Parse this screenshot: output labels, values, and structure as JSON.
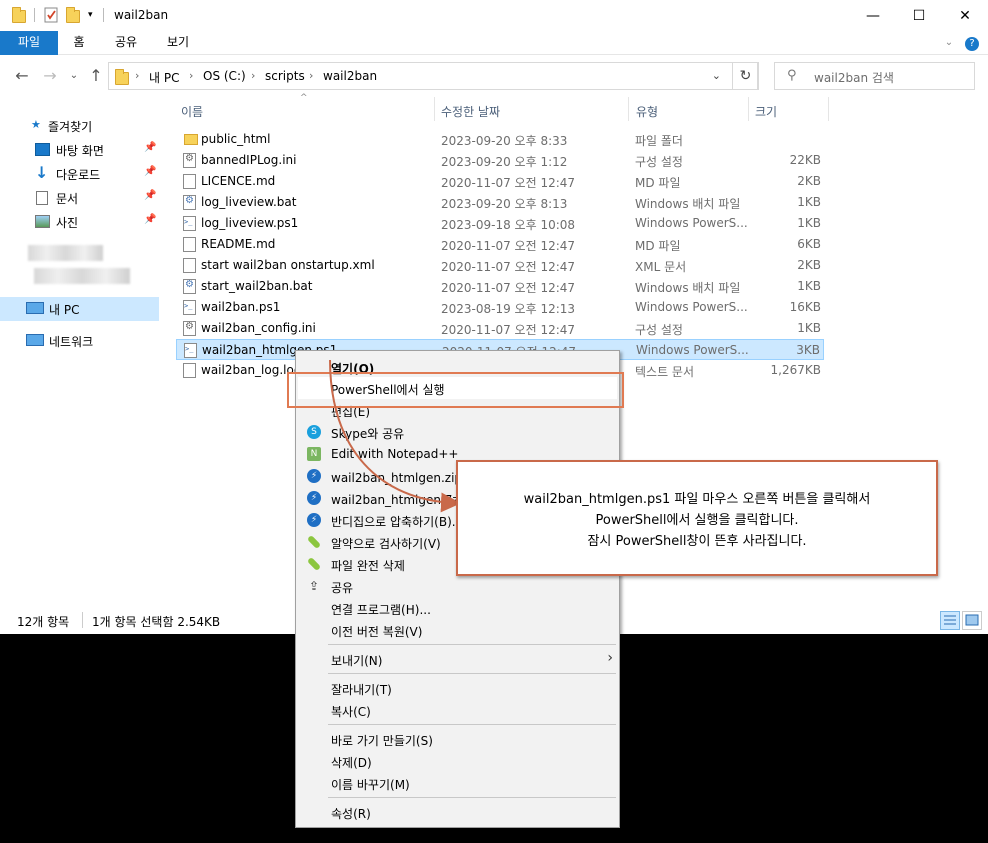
{
  "window": {
    "title": "wail2ban",
    "controls": [
      "—",
      "☐",
      "✕"
    ]
  },
  "ribbon": {
    "tabs": [
      "파일",
      "홈",
      "공유",
      "보기"
    ],
    "help_glyph": "?"
  },
  "address": {
    "crumbs": [
      "내 PC",
      "OS (C:)",
      "scripts",
      "wail2ban"
    ],
    "search_placeholder": "wail2ban 검색"
  },
  "nav_pane": {
    "quick_access": "즐겨찾기",
    "pinned": [
      "바탕 화면",
      "다운로드",
      "문서",
      "사진"
    ],
    "this_pc": "내 PC",
    "network": "네트워크"
  },
  "columns": [
    "이름",
    "수정한 날짜",
    "유형",
    "크기"
  ],
  "files": [
    {
      "name": "public_html",
      "date": "2023-09-20 오후 8:33",
      "type": "파일 폴더",
      "size": "",
      "icon": "folder"
    },
    {
      "name": "bannedIPLog.ini",
      "date": "2023-09-20 오후 1:12",
      "type": "구성 설정",
      "size": "22KB",
      "icon": "gear"
    },
    {
      "name": "LICENCE.md",
      "date": "2020-11-07 오전 12:47",
      "type": "MD 파일",
      "size": "2KB",
      "icon": "doc"
    },
    {
      "name": "log_liveview.bat",
      "date": "2023-09-20 오후 8:13",
      "type": "Windows 배치 파일",
      "size": "1KB",
      "icon": "bat"
    },
    {
      "name": "log_liveview.ps1",
      "date": "2023-09-18 오후 10:08",
      "type": "Windows PowerS...",
      "size": "1KB",
      "icon": "ps"
    },
    {
      "name": "README.md",
      "date": "2020-11-07 오전 12:47",
      "type": "MD 파일",
      "size": "6KB",
      "icon": "doc"
    },
    {
      "name": "start wail2ban onstartup.xml",
      "date": "2020-11-07 오전 12:47",
      "type": "XML 문서",
      "size": "2KB",
      "icon": "doc"
    },
    {
      "name": "start_wail2ban.bat",
      "date": "2020-11-07 오전 12:47",
      "type": "Windows 배치 파일",
      "size": "1KB",
      "icon": "bat"
    },
    {
      "name": "wail2ban.ps1",
      "date": "2023-08-19 오후 12:13",
      "type": "Windows PowerS...",
      "size": "16KB",
      "icon": "ps"
    },
    {
      "name": "wail2ban_config.ini",
      "date": "2020-11-07 오전 12:47",
      "type": "구성 설정",
      "size": "1KB",
      "icon": "gear"
    },
    {
      "name": "wail2ban_htmlgen.ps1",
      "date": "2020-11-07 오전 12:47",
      "type": "Windows PowerS...",
      "size": "3KB",
      "icon": "ps",
      "selected": true
    },
    {
      "name": "wail2ban_log.log",
      "date": "",
      "type": "텍스트 문서",
      "size": "1,267KB",
      "icon": "doc"
    }
  ],
  "status_bar": {
    "count": "12개 항목",
    "selection": "1개 항목 선택함 2.54KB"
  },
  "context_menu": {
    "items": [
      {
        "label": "열기(O)",
        "bold": true
      },
      {
        "label": "PowerShell에서 실행",
        "highlight": true
      },
      {
        "label": "편집(E)"
      },
      {
        "label": "Skype와 공유",
        "icon": "skype"
      },
      {
        "label": "Edit with Notepad++",
        "icon": "notepad"
      },
      {
        "label": "wail2ban_htmlgen.zip으로 압축하기",
        "icon": "bandizip"
      },
      {
        "label": "wail2ban_htmlgen.7z로 압축하기",
        "icon": "bandizip"
      },
      {
        "label": "반디집으로 압축하기(B)...",
        "icon": "bandizip"
      },
      {
        "label": "알약으로 검사하기(V)",
        "icon": "alyac"
      },
      {
        "label": "파일 완전 삭제",
        "icon": "alyac"
      },
      {
        "label": "공유",
        "icon": "share"
      },
      {
        "label": "연결 프로그램(H)..."
      },
      {
        "label": "이전 버전 복원(V)"
      },
      {
        "label": "보내기(N)",
        "submenu": true
      },
      {
        "label": "잘라내기(T)"
      },
      {
        "label": "복사(C)"
      },
      {
        "label": "바로 가기 만들기(S)"
      },
      {
        "label": "삭제(D)"
      },
      {
        "label": "이름 바꾸기(M)"
      },
      {
        "label": "속성(R)"
      }
    ]
  },
  "callout": {
    "lines": [
      "wail2ban_htmlgen.ps1 파일 마우스 오른쪽 버튼을 클릭해서",
      "PowerShell에서 실행을 클릭합니다.",
      "잠시 PowerShell창이 뜬후 사라집니다."
    ]
  },
  "colors": {
    "accent": "#1979ca",
    "selection": "#cce8ff",
    "annotation": "#e07a52"
  }
}
